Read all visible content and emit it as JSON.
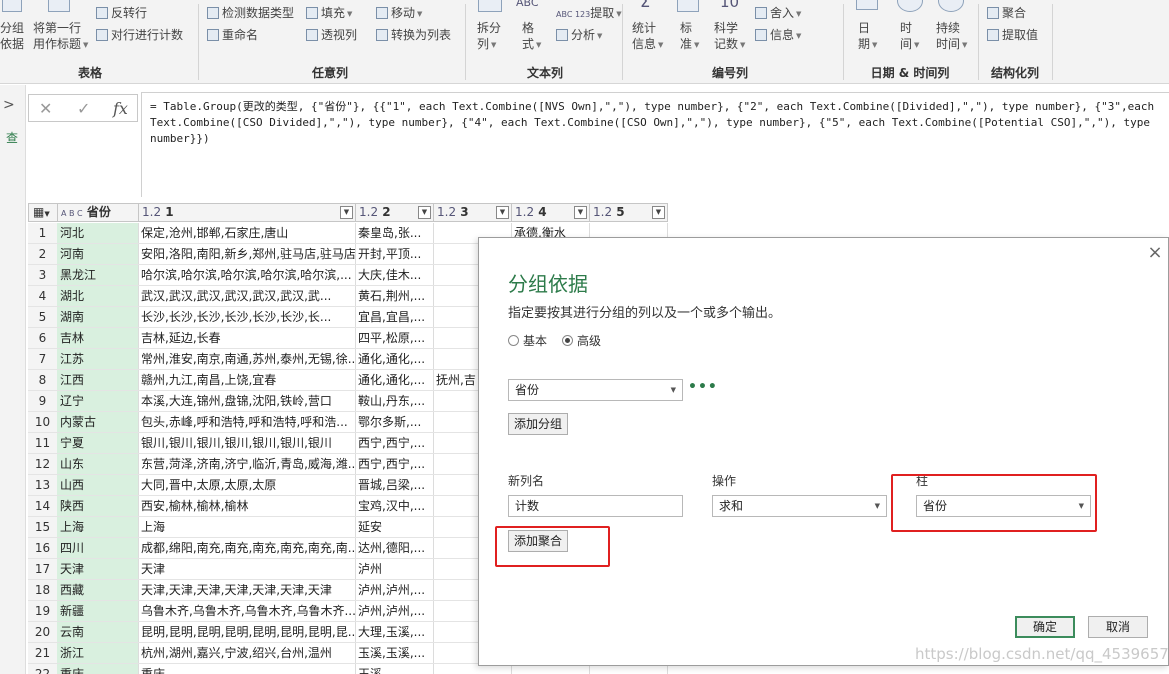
{
  "ribbon": {
    "group_by_line1": "分组",
    "group_by_line2": "依据",
    "use_first_row_line1": "将第一行",
    "use_first_row_line2": "用作标题",
    "transpose": "反转行",
    "count_rows": "对行进行计数",
    "detect_type": "检测数据类型",
    "rename": "重命名",
    "fill": "填充",
    "pivot": "透视列",
    "move": "移动",
    "to_list": "转换为列表",
    "split_line1": "拆分",
    "split_line2": "列",
    "format_line1": "格",
    "format_line2": "式",
    "extract": "提取",
    "parse": "分析",
    "stats_line1": "统计",
    "stats_line2": "信息",
    "standard_line1": "标",
    "standard_line2": "准",
    "scientific_line1": "科学",
    "scientific_line2": "记数",
    "rounding": "舍入",
    "info": "信息",
    "date_line1": "日",
    "date_line2": "期",
    "time_line1": "时",
    "time_line2": "间",
    "duration_line1": "持续",
    "duration_line2": "时间",
    "aggregate": "聚合",
    "extract_values": "提取值",
    "num_label": "10",
    "sigma": "Σ",
    "abc_label": "ABC",
    "abc123_label": "ABC 123",
    "group_table": "表格",
    "group_any_column": "任意列",
    "group_text_column": "文本列",
    "group_number_column": "编号列",
    "group_datetime": "日期 & 时间列",
    "group_structured": "结构化列"
  },
  "formula_bar": {
    "cancel": "✕",
    "confirm": "✓",
    "fx": "fx",
    "formula": "= Table.Group(更改的类型, {\"省份\"}, {{\"1\", each Text.Combine([NVS Own],\",\"), type number}, {\"2\", each Text.Combine([Divided],\",\"), type number}, {\"3\",each Text.Combine([CSO Divided],\",\"), type number}, {\"4\", each Text.Combine([CSO Own],\",\"), type number}, {\"5\", each Text.Combine([Potential CSO],\",\"), type number}})"
  },
  "table": {
    "type_abc": "A B C",
    "type_num": "1.2",
    "columns": [
      "省份",
      "1",
      "2",
      "3",
      "4",
      "5"
    ],
    "rows": [
      {
        "idx": "1",
        "prov": "河北",
        "c1": "保定,沧州,邯郸,石家庄,唐山",
        "c2": "秦皇岛,张...",
        "c3": "",
        "c4": "承德,衡水",
        "c5": ""
      },
      {
        "idx": "2",
        "prov": "河南",
        "c1": "安阳,洛阳,南阳,新乡,郑州,驻马店,驻马店",
        "c2": "开封,平顶...",
        "c3": "",
        "c4": "",
        "c5": ""
      },
      {
        "idx": "3",
        "prov": "黑龙江",
        "c1": "哈尔滨,哈尔滨,哈尔滨,哈尔滨,哈尔滨,...",
        "c2": "大庆,佳木...",
        "c3": "",
        "c4": "",
        "c5": ""
      },
      {
        "idx": "4",
        "prov": "湖北",
        "c1": "武汉,武汉,武汉,武汉,武汉,武汉,武...",
        "c2": "黄石,荆州,...",
        "c3": "",
        "c4": "",
        "c5": ""
      },
      {
        "idx": "5",
        "prov": "湖南",
        "c1": "长沙,长沙,长沙,长沙,长沙,长沙,长...",
        "c2": "宜昌,宜昌,...",
        "c3": "",
        "c4": "",
        "c5": ""
      },
      {
        "idx": "6",
        "prov": "吉林",
        "c1": "吉林,延边,长春",
        "c2": "四平,松原,...",
        "c3": "",
        "c4": "",
        "c5": ""
      },
      {
        "idx": "7",
        "prov": "江苏",
        "c1": "常州,淮安,南京,南通,苏州,泰州,无锡,徐...",
        "c2": "通化,通化,...",
        "c3": "",
        "c4": "",
        "c5": ""
      },
      {
        "idx": "8",
        "prov": "江西",
        "c1": "赣州,九江,南昌,上饶,宜春",
        "c2": "通化,通化,...",
        "c3": "抚州,吉",
        "c4": "",
        "c5": ""
      },
      {
        "idx": "9",
        "prov": "辽宁",
        "c1": "本溪,大连,锦州,盘锦,沈阳,铁岭,营口",
        "c2": "鞍山,丹东,...",
        "c3": "",
        "c4": "",
        "c5": ""
      },
      {
        "idx": "10",
        "prov": "内蒙古",
        "c1": "包头,赤峰,呼和浩特,呼和浩特,呼和浩...",
        "c2": "鄂尔多斯,...",
        "c3": "",
        "c4": "",
        "c5": ""
      },
      {
        "idx": "11",
        "prov": "宁夏",
        "c1": "银川,银川,银川,银川,银川,银川,银川",
        "c2": "西宁,西宁,...",
        "c3": "",
        "c4": "",
        "c5": ""
      },
      {
        "idx": "12",
        "prov": "山东",
        "c1": "东营,菏泽,济南,济宁,临沂,青岛,威海,潍...",
        "c2": "西宁,西宁,...",
        "c3": "",
        "c4": "",
        "c5": ""
      },
      {
        "idx": "13",
        "prov": "山西",
        "c1": "大同,晋中,太原,太原,太原",
        "c2": "晋城,吕梁,...",
        "c3": "",
        "c4": "",
        "c5": ""
      },
      {
        "idx": "14",
        "prov": "陕西",
        "c1": "西安,榆林,榆林,榆林",
        "c2": "宝鸡,汉中,...",
        "c3": "",
        "c4": "",
        "c5": ""
      },
      {
        "idx": "15",
        "prov": "上海",
        "c1": "上海",
        "c2": "延安",
        "c3": "",
        "c4": "",
        "c5": ""
      },
      {
        "idx": "16",
        "prov": "四川",
        "c1": "成都,绵阳,南充,南充,南充,南充,南充,南...",
        "c2": "达州,德阳,...",
        "c3": "",
        "c4": "",
        "c5": ""
      },
      {
        "idx": "17",
        "prov": "天津",
        "c1": "天津",
        "c2": "泸州",
        "c3": "",
        "c4": "",
        "c5": ""
      },
      {
        "idx": "18",
        "prov": "西藏",
        "c1": "天津,天津,天津,天津,天津,天津,天津",
        "c2": "泸州,泸州,...",
        "c3": "",
        "c4": "",
        "c5": ""
      },
      {
        "idx": "19",
        "prov": "新疆",
        "c1": "乌鲁木齐,乌鲁木齐,乌鲁木齐,乌鲁木齐...",
        "c2": "泸州,泸州,...",
        "c3": "",
        "c4": "",
        "c5": ""
      },
      {
        "idx": "20",
        "prov": "云南",
        "c1": "昆明,昆明,昆明,昆明,昆明,昆明,昆明,昆...",
        "c2": "大理,玉溪,...",
        "c3": "",
        "c4": "",
        "c5": ""
      },
      {
        "idx": "21",
        "prov": "浙江",
        "c1": "杭州,湖州,嘉兴,宁波,绍兴,台州,温州",
        "c2": "玉溪,玉溪,...",
        "c3": "",
        "c4": "",
        "c5": ""
      },
      {
        "idx": "22",
        "prov": "重庆",
        "c1": "重庆",
        "c2": "玉溪",
        "c3": "",
        "c4": "",
        "c5": ""
      }
    ]
  },
  "dialog": {
    "close": "×",
    "title": "分组依据",
    "subtitle": "指定要按其进行分组的列以及一个或多个输出。",
    "radio_basic": "基本",
    "radio_advanced": "高级",
    "group_column": "省份",
    "more": "•••",
    "add_group": "添加分组",
    "new_column_label": "新列名",
    "operation_label": "操作",
    "column_label": "柱",
    "new_column_value": "计数",
    "operation_value": "求和",
    "column_value": "省份",
    "add_aggregation": "添加聚合",
    "ok": "确定",
    "cancel": "取消"
  },
  "left_panel": {
    "collapse": ">",
    "label": "查"
  },
  "watermark": "https://blog.csdn.net/qq_45396577"
}
